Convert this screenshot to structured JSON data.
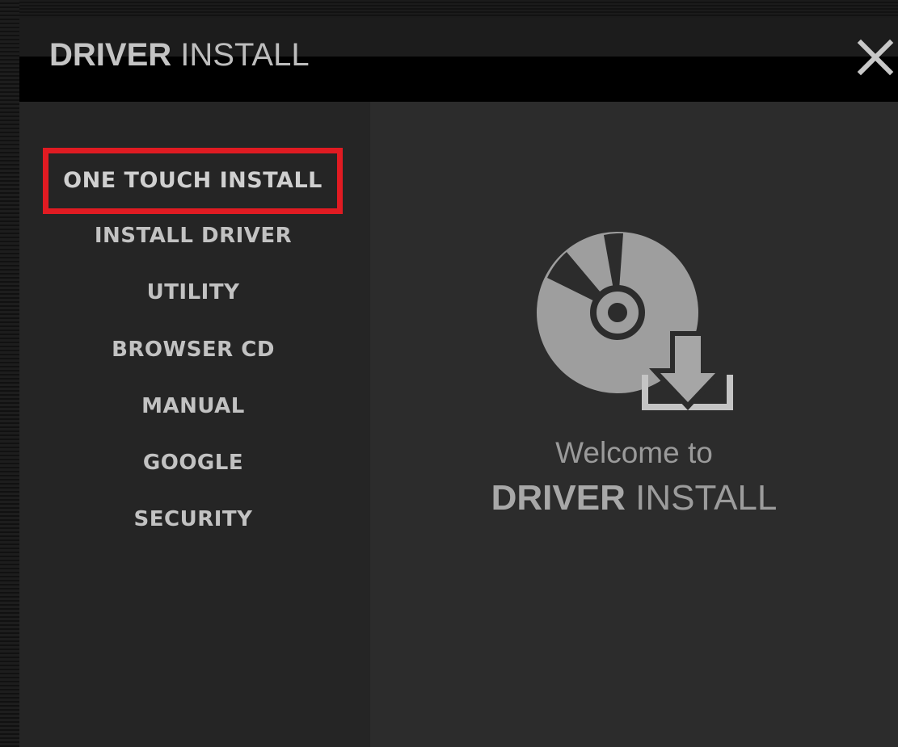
{
  "window": {
    "title_bold": "DRIVER",
    "title_rest": "INSTALL"
  },
  "sidebar": {
    "items": [
      {
        "label": "ONE TOUCH INSTALL",
        "highlighted": true
      },
      {
        "label": "INSTALL DRIVER"
      },
      {
        "label": "UTILITY"
      },
      {
        "label": "BROWSER CD"
      },
      {
        "label": "MANUAL"
      },
      {
        "label": "GOOGLE"
      },
      {
        "label": "SECURITY"
      }
    ]
  },
  "welcome": {
    "line1": "Welcome to",
    "product_bold": "DRIVER",
    "product_rest": "INSTALL"
  },
  "colors": {
    "highlight_border": "#e01b22",
    "background": "#2b2b2b",
    "sidebar": "#252525",
    "text": "#c2c2c2"
  },
  "icons": {
    "close": "close-icon",
    "hero": "disc-download-icon"
  }
}
